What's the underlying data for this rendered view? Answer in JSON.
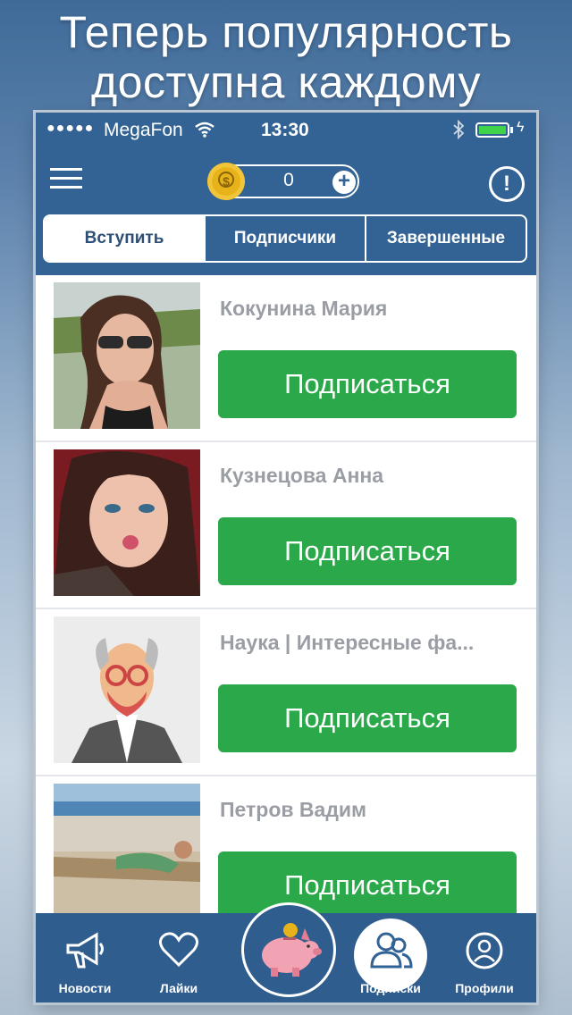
{
  "promo": {
    "line1": "Теперь популярность",
    "line2": "доступна каждому"
  },
  "status_bar": {
    "carrier": "MegaFon",
    "time": "13:30",
    "battery_level": 1.0,
    "battery_color": "#3fd24a"
  },
  "header": {
    "coin_balance": "0"
  },
  "tabs": [
    {
      "label": "Вступить",
      "active": true
    },
    {
      "label": "Подписчики",
      "active": false
    },
    {
      "label": "Завершенные",
      "active": false
    }
  ],
  "list": [
    {
      "name": "Кокунина Мария",
      "button": "Подписаться"
    },
    {
      "name": "Кузнецова Анна",
      "button": "Подписаться"
    },
    {
      "name": "Наука | Интересные фа...",
      "button": "Подписаться"
    },
    {
      "name": "Петров Вадим",
      "button": "Подписаться"
    }
  ],
  "tabbar": {
    "items": [
      {
        "label": "Новости",
        "icon": "megaphone-icon"
      },
      {
        "label": "Лайки",
        "icon": "heart-icon"
      },
      {
        "label": "",
        "icon": "piggy-bank-icon"
      },
      {
        "label": "Подписки",
        "icon": "users-icon"
      },
      {
        "label": "Профили",
        "icon": "profile-icon"
      }
    ]
  },
  "colors": {
    "header_bg": "#336394",
    "tabbar_bg": "#2f5d8e",
    "subscribe_button": "#2aa84a",
    "coin": "#e8b31a"
  }
}
